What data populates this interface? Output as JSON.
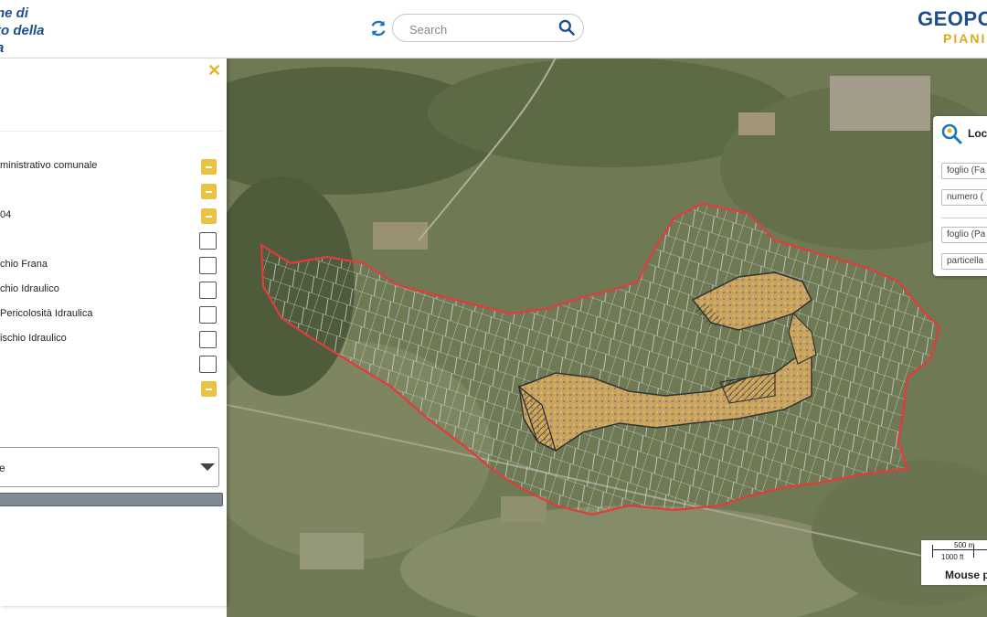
{
  "header": {
    "site_title": "ne di\nto della\na",
    "search_placeholder": "Search",
    "logo_line1": "GEOPO",
    "logo_line2": "PIANI"
  },
  "panel": {
    "layers": [
      {
        "label": "ministrativo comunale",
        "control": "minus"
      },
      {
        "label": "",
        "control": "minus"
      },
      {
        "label": "04",
        "control": "minus"
      },
      {
        "label": "",
        "control": "checkbox"
      },
      {
        "label": "chio Frana",
        "control": "checkbox"
      },
      {
        "label": "chio Idraulico",
        "control": "checkbox"
      },
      {
        "label": "Pericolosità Idraulica",
        "control": "checkbox"
      },
      {
        "label": "ischio Idraulico",
        "control": "checkbox"
      },
      {
        "label": "",
        "control": "checkbox"
      },
      {
        "label": "",
        "control": "minus"
      }
    ],
    "dropdown_value": "e",
    "progress_percent": 100
  },
  "locate": {
    "title": "Loc",
    "fields": [
      "foglio (Fa",
      "numero (",
      "foglio (Pa",
      "particella"
    ]
  },
  "scale": {
    "metric": "500 m",
    "imperial": "1000 ft",
    "mouse": "Mouse p"
  },
  "colors": {
    "accent": "#e3b529",
    "brand": "#1f4e8c",
    "boundary": "#e23b3b"
  }
}
